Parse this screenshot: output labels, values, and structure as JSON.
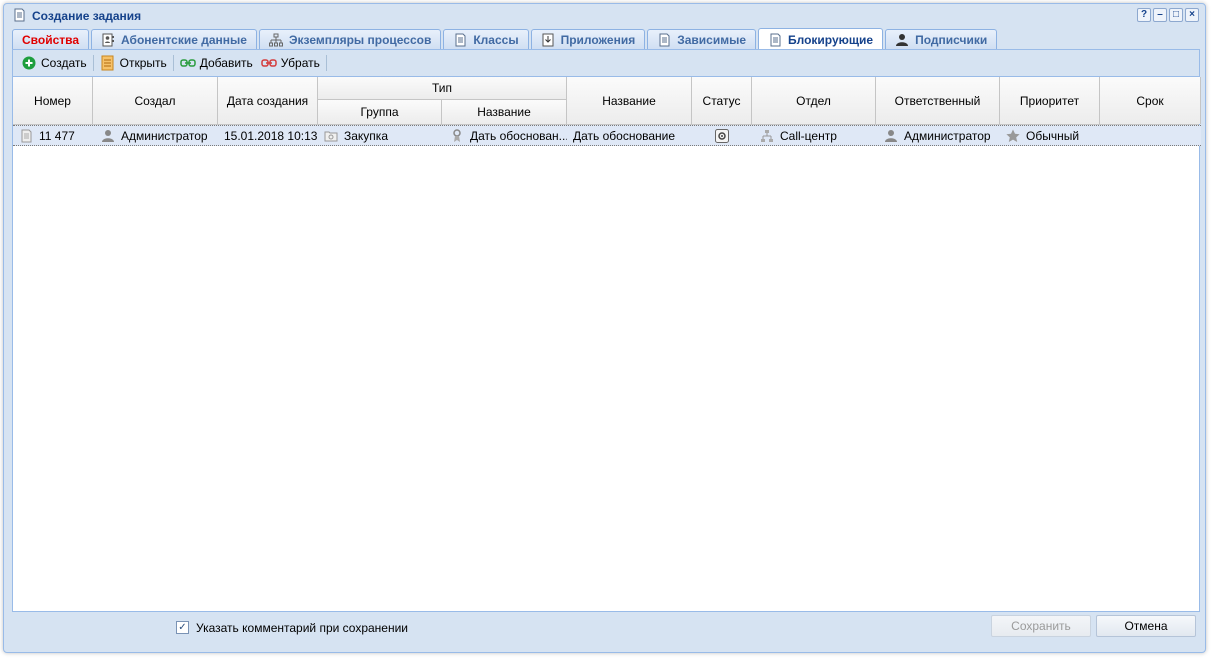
{
  "window": {
    "title": "Создание задания",
    "title_icon": "document-icon",
    "tools": [
      "help-icon",
      "minimize-icon",
      "maximize-icon",
      "close-icon"
    ],
    "tool_glyphs": [
      "?",
      "–",
      "□",
      "×"
    ]
  },
  "tabs": [
    {
      "label": "Свойства",
      "icon": "",
      "state": "red"
    },
    {
      "label": "Абонентские данные",
      "icon": "contact-card-icon",
      "state": ""
    },
    {
      "label": "Экземпляры процессов",
      "icon": "process-tree-icon",
      "state": ""
    },
    {
      "label": "Классы",
      "icon": "document-icon",
      "state": ""
    },
    {
      "label": "Приложения",
      "icon": "attachment-icon",
      "state": ""
    },
    {
      "label": "Зависимые",
      "icon": "document-icon",
      "state": ""
    },
    {
      "label": "Блокирующие",
      "icon": "document-icon",
      "state": "active"
    },
    {
      "label": "Подписчики",
      "icon": "user-icon",
      "state": ""
    }
  ],
  "toolbar": {
    "create_label": "Создать",
    "open_label": "Открыть",
    "add_label": "Добавить",
    "remove_label": "Убрать"
  },
  "grid": {
    "columns": {
      "number": "Номер",
      "created_by": "Создал",
      "created_date": "Дата создания",
      "type": "Тип",
      "type_group": "Группа",
      "type_name": "Название",
      "name": "Название",
      "status": "Статус",
      "department": "Отдел",
      "responsible": "Ответственный",
      "priority": "Приоритет",
      "deadline": "Срок"
    },
    "rows": [
      {
        "number": "11 477",
        "created_by": "Администратор",
        "created_date": "15.01.2018 10:13",
        "type_group": "Закупка",
        "type_name": "Дать обоснован...",
        "name": "Дать обоснование",
        "status_icon": "gear-status-icon",
        "department": "Call-центр",
        "responsible": "Администратор",
        "priority": "Обычный",
        "deadline": ""
      }
    ]
  },
  "footer": {
    "comment_checkbox_checked": true,
    "comment_checkbox_label": "Указать комментарий при сохранении",
    "save_label": "Сохранить",
    "cancel_label": "Отмена"
  },
  "colors": {
    "accent": "#15428b",
    "frame": "#d6e3f2",
    "selected_row": "#dfe8f6",
    "red_tab": "#e00000"
  }
}
